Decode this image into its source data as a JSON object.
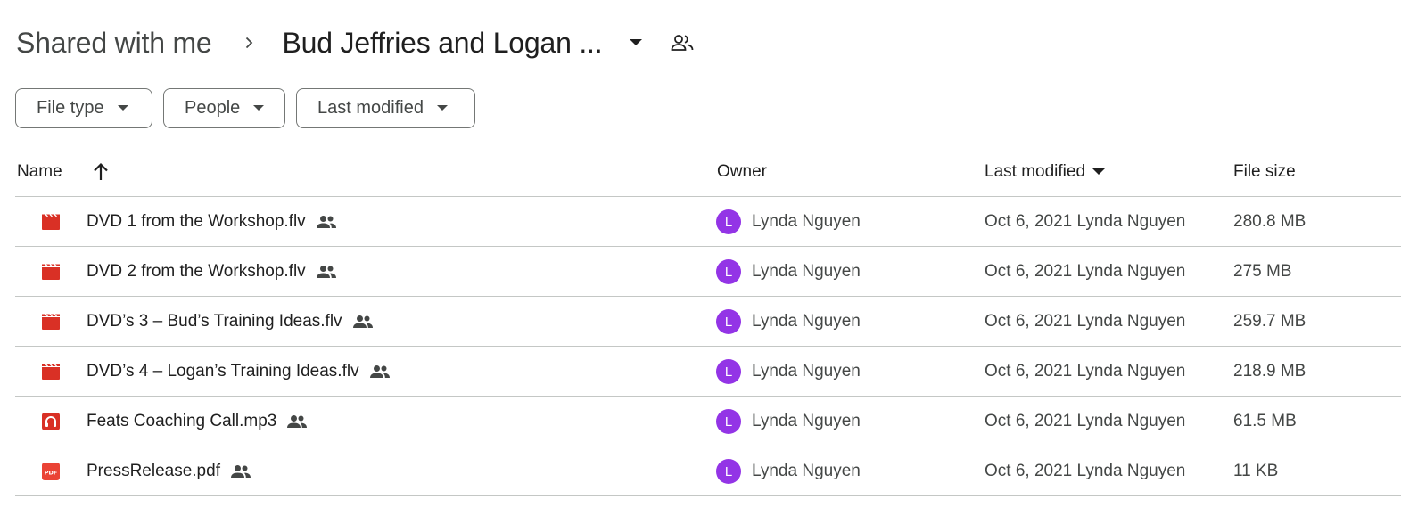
{
  "breadcrumb": {
    "root": "Shared with me",
    "current": "Bud Jeffries and Logan ..."
  },
  "filters": [
    {
      "label": "File type"
    },
    {
      "label": "People"
    },
    {
      "label": "Last modified"
    }
  ],
  "columns": {
    "name": "Name",
    "owner": "Owner",
    "last_modified": "Last modified",
    "file_size": "File size"
  },
  "colors": {
    "video": "#d93025",
    "audio": "#d93025",
    "pdf": "#ea4335",
    "avatar": "#9334e6"
  },
  "files": [
    {
      "icon": "video-file-icon",
      "name": "DVD 1 from the Workshop.flv",
      "owner_initial": "L",
      "owner": "Lynda Nguyen",
      "modified": "Oct 6, 2021 Lynda Nguyen",
      "size": "280.8 MB"
    },
    {
      "icon": "video-file-icon",
      "name": "DVD 2 from the Workshop.flv",
      "owner_initial": "L",
      "owner": "Lynda Nguyen",
      "modified": "Oct 6, 2021 Lynda Nguyen",
      "size": "275 MB"
    },
    {
      "icon": "video-file-icon",
      "name": "DVD’s 3 – Bud’s Training Ideas.flv",
      "owner_initial": "L",
      "owner": "Lynda Nguyen",
      "modified": "Oct 6, 2021 Lynda Nguyen",
      "size": "259.7 MB"
    },
    {
      "icon": "video-file-icon",
      "name": "DVD’s 4 – Logan’s Training Ideas.flv",
      "owner_initial": "L",
      "owner": "Lynda Nguyen",
      "modified": "Oct 6, 2021 Lynda Nguyen",
      "size": "218.9 MB"
    },
    {
      "icon": "audio-file-icon",
      "name": "Feats Coaching Call.mp3",
      "owner_initial": "L",
      "owner": "Lynda Nguyen",
      "modified": "Oct 6, 2021 Lynda Nguyen",
      "size": "61.5 MB"
    },
    {
      "icon": "pdf-file-icon",
      "name": "PressRelease.pdf",
      "owner_initial": "L",
      "owner": "Lynda Nguyen",
      "modified": "Oct 6, 2021 Lynda Nguyen",
      "size": "11 KB"
    }
  ]
}
